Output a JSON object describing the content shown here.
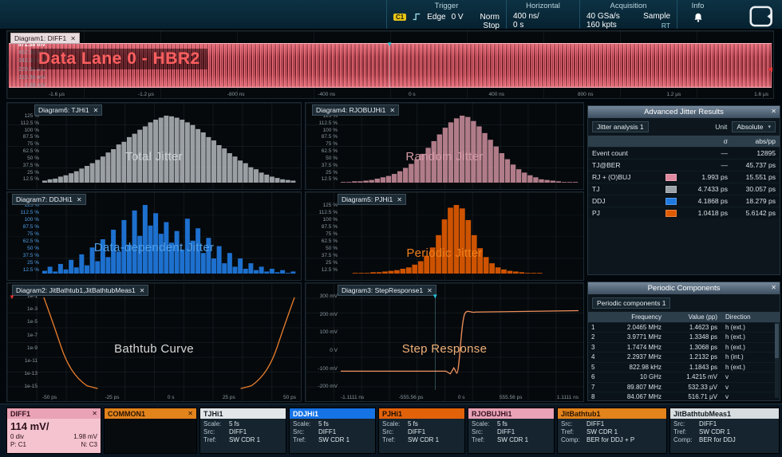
{
  "ui": {
    "close": "✕"
  },
  "header": {
    "trigger": {
      "title": "Trigger",
      "source": "C1",
      "type": "Edge",
      "level": "0 V",
      "mode": "Norm",
      "state": "Stop"
    },
    "horizontal": {
      "title": "Horizontal",
      "scale": "400 ns/",
      "position": "0 s"
    },
    "acquisition": {
      "title": "Acquisition",
      "sample_rate": "40 GSa/s",
      "mode": "Sample",
      "record_length": "160 kpts",
      "rt": "RT"
    },
    "info": {
      "title": "Info"
    }
  },
  "diagram1": {
    "tab": "Diagram1: DIFF1",
    "overlay": "Data Lane 0 - HBR2",
    "y_labels": [
      "571.38 mV",
      "457.38 mV",
      "343.38 mV",
      "229.38 mV",
      "115.38 mV",
      "1.38 mV"
    ],
    "x_labels": [
      "-1.6 μs",
      "-1.2 μs",
      "-800 ns",
      "-400 ns",
      "0 s",
      "400 ns",
      "800 ns",
      "1.2 μs",
      "1.6 μs"
    ]
  },
  "percent_labels": [
    "125 %",
    "112.5 %",
    "100 %",
    "87.5 %",
    "75 %",
    "62.5 %",
    "50 %",
    "37.5 %",
    "25 %",
    "12.5 %"
  ],
  "histograms": {
    "tj": {
      "tab": "Diagram6: TJHi1",
      "label": "Total Jitter",
      "label_color": "#ccd2d6",
      "color": "#a7adb2",
      "values": [
        3,
        5,
        6,
        9,
        11,
        14,
        17,
        21,
        25,
        29,
        34,
        39,
        45,
        50,
        57,
        61,
        68,
        73,
        79,
        84,
        90,
        94,
        97,
        100,
        99,
        97,
        94,
        90,
        86,
        80,
        75,
        68,
        63,
        56,
        51,
        44,
        39,
        33,
        29,
        23,
        20,
        15,
        12,
        9,
        7,
        5,
        4,
        3
      ]
    },
    "rj": {
      "tab": "Diagram4: RJOBUJHi1",
      "label": "Random Jitter",
      "label_color": "#d49aa6",
      "color": "#c08795",
      "values": [
        1,
        1,
        2,
        2,
        3,
        4,
        6,
        8,
        10,
        13,
        17,
        22,
        28,
        35,
        43,
        52,
        62,
        72,
        82,
        90,
        96,
        100,
        98,
        92,
        84,
        74,
        64,
        54,
        44,
        35,
        27,
        20,
        15,
        11,
        8,
        5,
        4,
        3,
        2,
        1,
        1,
        1
      ]
    },
    "ddj": {
      "tab": "Diagram7: DDJHi1",
      "label": "Data-dependent Jitter",
      "label_color": "#4f9fe8",
      "color": "#1f7ae0",
      "values": [
        4,
        10,
        3,
        14,
        6,
        20,
        9,
        28,
        12,
        38,
        18,
        50,
        24,
        64,
        32,
        78,
        42,
        92,
        55,
        100,
        70,
        88,
        58,
        75,
        45,
        62,
        35,
        80,
        48,
        66,
        30,
        52,
        22,
        40,
        15,
        30,
        10,
        22,
        7,
        15,
        5,
        10,
        3,
        7,
        2,
        5,
        1,
        3
      ]
    },
    "pj": {
      "tab": "Diagram5: PJHi1",
      "label": "Periodic Jitter",
      "label_color": "#ef7f1a",
      "color": "#e05a00",
      "values": [
        0,
        0,
        1,
        1,
        1,
        2,
        2,
        3,
        4,
        5,
        7,
        9,
        13,
        18,
        26,
        38,
        56,
        79,
        96,
        100,
        95,
        78,
        56,
        37,
        24,
        15,
        9,
        6,
        4,
        3,
        2,
        1,
        1,
        1,
        0,
        0,
        0,
        0,
        0,
        0
      ]
    }
  },
  "bathtub": {
    "tab": "Diagram2: JitBathtub1,JitBathtubMeas1",
    "label": "Bathtub Curve",
    "y_labels": [
      "1e-1",
      "1e-3",
      "1e-5",
      "1e-7",
      "1e-9",
      "1e-11",
      "1e-13",
      "1e-15"
    ],
    "x_labels": [
      "-50 ps",
      "-25 ps",
      "0 s",
      "25 ps",
      "50 ps"
    ]
  },
  "step": {
    "tab": "Diagram3: StepResponse1",
    "label": "Step Response",
    "y_labels": [
      "300 mV",
      "200 mV",
      "100 mV",
      "0 V",
      "-100 mV",
      "-200 mV"
    ],
    "x_labels": [
      "-1.1111 ns",
      "-555.56 ps",
      "0 s",
      "555.56 ps",
      "1.1111 ns"
    ]
  },
  "jitter_results": {
    "title": "Advanced Jitter Results",
    "analysis": "Jitter analysis 1",
    "unit_label": "Unit",
    "unit_value": "Absolute",
    "col_sigma": "σ",
    "col_abspp": "abs/pp",
    "rows": [
      {
        "name": "Event count",
        "swatch": null,
        "sigma": "—",
        "abspp": "12895"
      },
      {
        "name": "TJ@BER",
        "swatch": null,
        "sigma": "—",
        "abspp": "45.737 ps"
      },
      {
        "name": "RJ + (O)BUJ",
        "swatch": "#e08aa0",
        "sigma": "1.993 ps",
        "abspp": "15.551 ps"
      },
      {
        "name": "TJ",
        "swatch": "#9aa2a8",
        "sigma": "4.7433 ps",
        "abspp": "30.057 ps"
      },
      {
        "name": "DDJ",
        "swatch": "#1f7ae0",
        "sigma": "4.1868 ps",
        "abspp": "18.279 ps"
      },
      {
        "name": "PJ",
        "swatch": "#e05a00",
        "sigma": "1.0418 ps",
        "abspp": "5.6142 ps"
      }
    ]
  },
  "periodic": {
    "title": "Periodic Components",
    "selector": "Periodic components 1",
    "col_freq": "Frequency",
    "col_value": "Value (pp)",
    "col_dir": "Direction",
    "rows": [
      {
        "idx": "1",
        "freq": "2.0465 MHz",
        "value": "1.4623 ps",
        "dir": "h (ext.)"
      },
      {
        "idx": "2",
        "freq": "3.9771 MHz",
        "value": "1.3348 ps",
        "dir": "h (ext.)"
      },
      {
        "idx": "3",
        "freq": "1.7474 MHz",
        "value": "1.3068 ps",
        "dir": "h (ext.)"
      },
      {
        "idx": "4",
        "freq": "2.2937 MHz",
        "value": "1.2132 ps",
        "dir": "h (int.)"
      },
      {
        "idx": "5",
        "freq": "822.98 kHz",
        "value": "1.1843 ps",
        "dir": "h (ext.)"
      },
      {
        "idx": "6",
        "freq": "10 GHz",
        "value": "1.4215 mV",
        "dir": "v"
      },
      {
        "idx": "7",
        "freq": "89.807 MHz",
        "value": "532.33 μV",
        "dir": "v"
      },
      {
        "idx": "8",
        "freq": "84.067 MHz",
        "value": "516.71 μV",
        "dir": "v"
      }
    ]
  },
  "signalbar": {
    "tabs": [
      {
        "kind": "diff",
        "name": "DIFF1",
        "close": "✕",
        "header_bg": "#e9a2b6",
        "header_fg": "#33101c",
        "body_bg": "#f4c3cf",
        "big": "114 mV/",
        "pairs": [
          [
            "0 div",
            "1.98 mV"
          ],
          [
            "P: C1",
            "N: C3"
          ]
        ]
      },
      {
        "kind": "common",
        "name": "COMMON1",
        "close": "✕",
        "header_bg": "#e2831c",
        "header_fg": "#2a1502"
      },
      {
        "kind": "info",
        "name": "TJHi1",
        "header_bg": "#e2e6e9",
        "header_fg": "#131b21",
        "rows": [
          [
            "Scale:",
            "5 fs"
          ],
          [
            "Src:",
            "DIFF1"
          ],
          [
            "Tref:",
            "SW CDR 1"
          ]
        ]
      },
      {
        "kind": "info",
        "name": "DDJHi1",
        "header_bg": "#1673e6",
        "header_fg": "#ffffff",
        "rows": [
          [
            "Scale:",
            "5 fs"
          ],
          [
            "Src:",
            "DIFF1"
          ],
          [
            "Tref:",
            "SW CDR 1"
          ]
        ]
      },
      {
        "kind": "info",
        "name": "PJHi1",
        "header_bg": "#e2620a",
        "header_fg": "#1d0e02",
        "rows": [
          [
            "Scale:",
            "5 fs"
          ],
          [
            "Src:",
            "DIFF1"
          ],
          [
            "Tref:",
            "SW CDR 1"
          ]
        ]
      },
      {
        "kind": "info",
        "name": "RJOBUJHi1",
        "header_bg": "#e9a2b6",
        "header_fg": "#33101c",
        "rows": [
          [
            "Scale:",
            "5 fs"
          ],
          [
            "Src:",
            "DIFF1"
          ],
          [
            "Tref:",
            "SW CDR 1"
          ]
        ]
      },
      {
        "kind": "wide",
        "name": "JitBathtub1",
        "header_bg": "#e2831c",
        "header_fg": "#2a1502",
        "rows": [
          [
            "Src:",
            "DIFF1"
          ],
          [
            "Tref:",
            "SW CDR 1"
          ],
          [
            "Comp:",
            "BER for DDJ + P"
          ]
        ]
      },
      {
        "kind": "wide",
        "name": "JitBathtubMeas1",
        "header_bg": "#d7dcdf",
        "header_fg": "#131b21",
        "rows": [
          [
            "Src:",
            "DIFF1"
          ],
          [
            "Tref:",
            "SW CDR 1"
          ],
          [
            "Comp:",
            "BER for DDJ"
          ]
        ]
      }
    ]
  }
}
